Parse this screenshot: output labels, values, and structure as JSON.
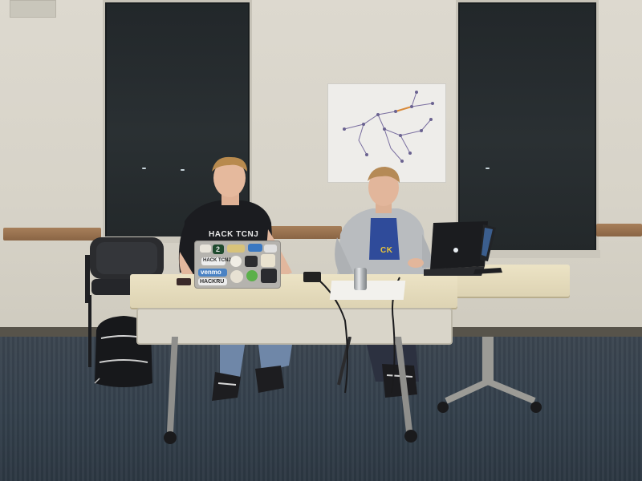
{
  "scene": {
    "description_tag": "photo",
    "colors": {
      "wall": "#d9d6cc",
      "floor": "#36414c",
      "window": "#252a2d",
      "table": "#e6dcbd",
      "rail_wood": "#9a7350"
    }
  },
  "stickers": {
    "hack_tcnj": "HACK TCNJ",
    "venmo": "venmo",
    "hackru": "HACKRU",
    "two": "2"
  },
  "shirt": {
    "text": "HACK TCNJ"
  },
  "shirt2": {
    "text": "CK"
  }
}
